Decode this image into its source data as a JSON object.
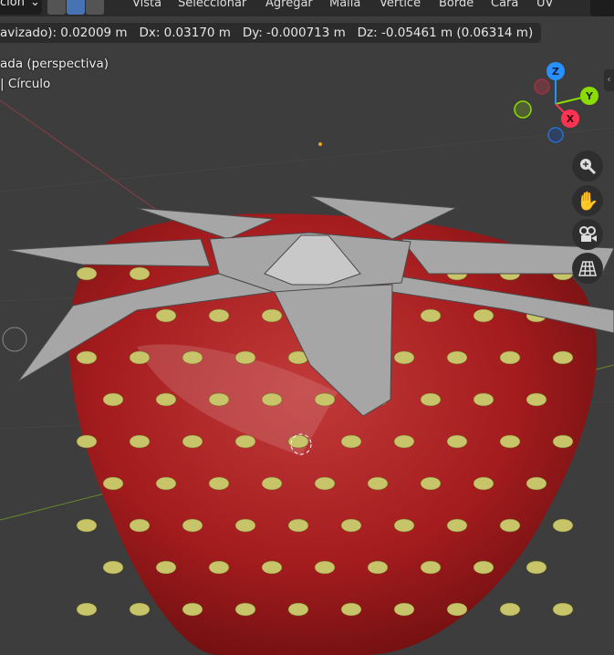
{
  "header": {
    "mode_label": "ción",
    "menus": [
      "Vista",
      "Seleccionar",
      "Agregar",
      "Malla",
      "Vértice",
      "Borde",
      "Cara",
      "UV"
    ]
  },
  "status": {
    "text": "avizado): 0.02009 m   Dx: 0.03170 m   Dy: -0.000713 m   Dz: -0.05461 m (0.06314 m)"
  },
  "overlay": {
    "view_name": "ada (perspectiva)",
    "object_name": "| Círculo"
  },
  "gizmo": {
    "axes": [
      "Z",
      "Y",
      "X"
    ],
    "colors": {
      "x": "#ff3352",
      "y": "#8bdc00",
      "z": "#2890ff"
    }
  },
  "nav_buttons": [
    "zoom",
    "pan",
    "camera",
    "ortho-grid"
  ]
}
